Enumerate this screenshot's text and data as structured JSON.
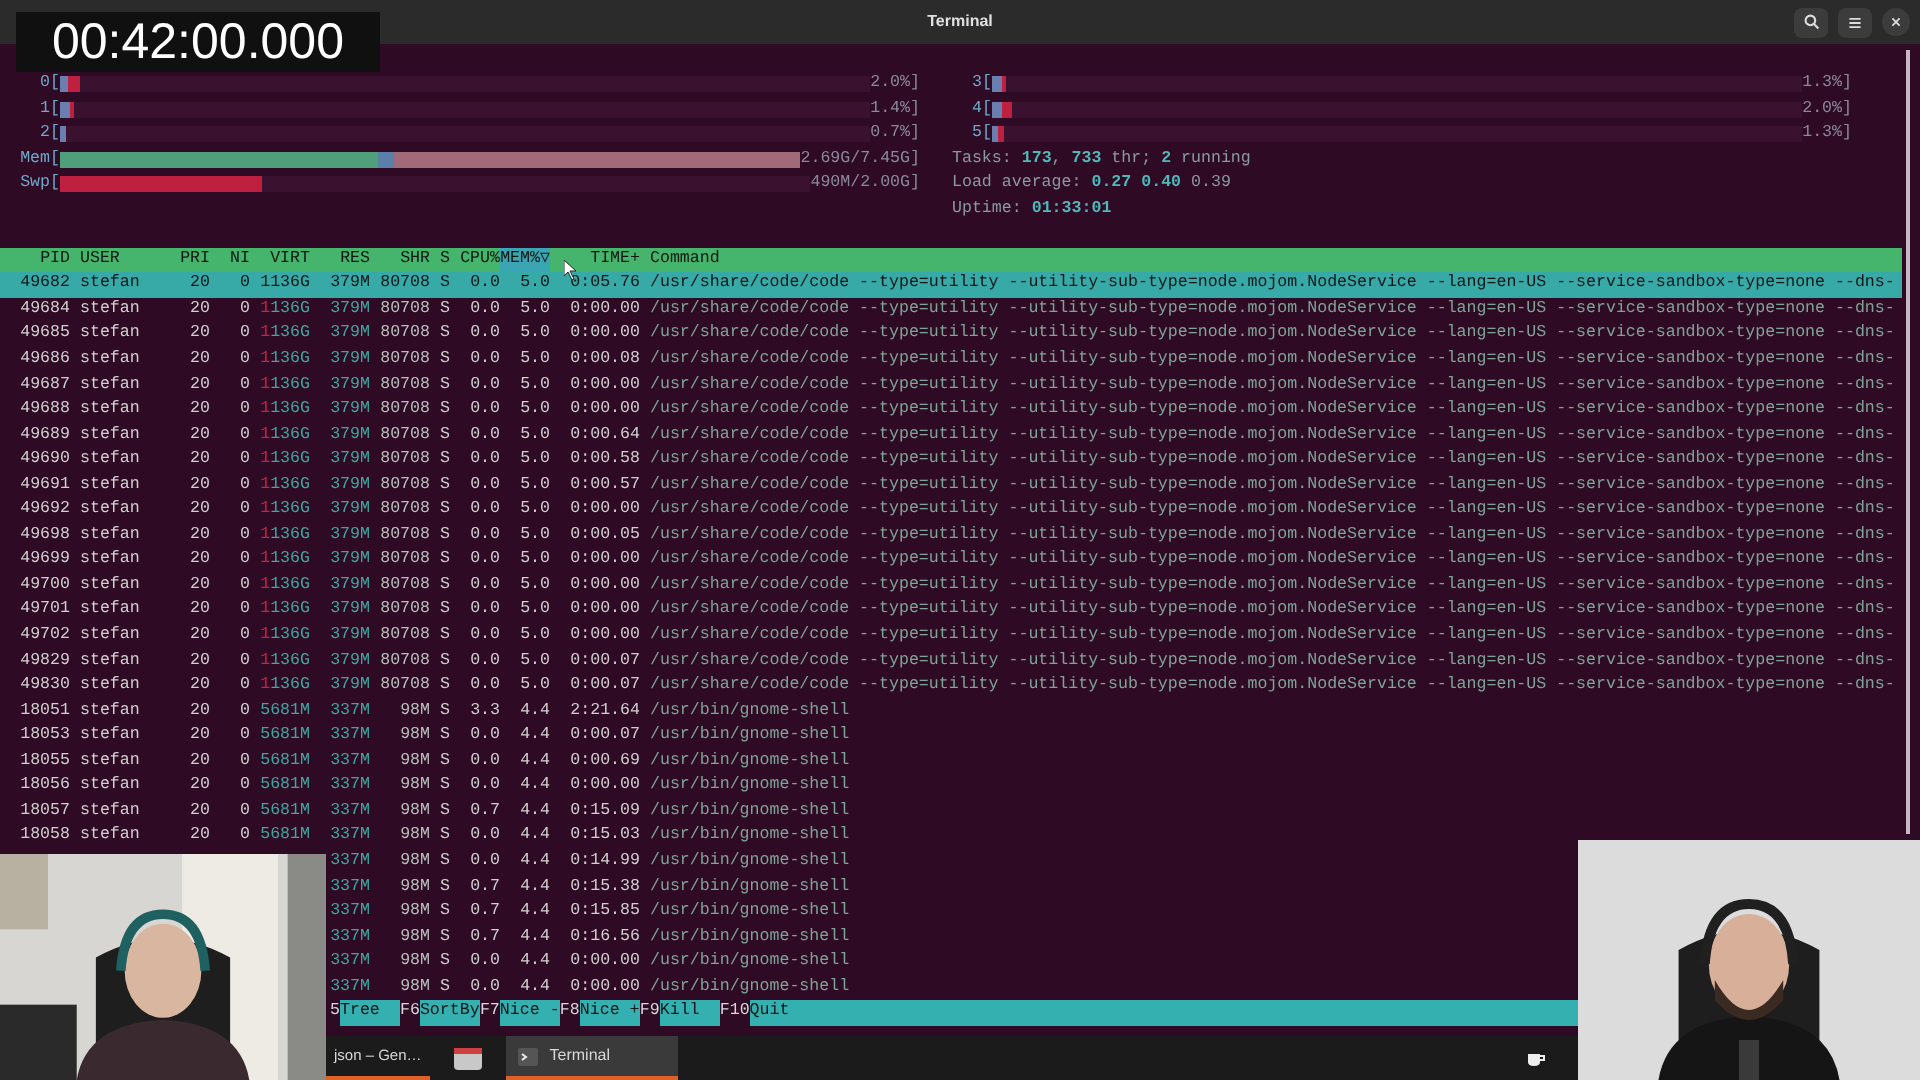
{
  "timer": "00:42:00.000",
  "window": {
    "title": "Terminal"
  },
  "left_meters": [
    {
      "label": "0[",
      "value": "2.0%]",
      "segments": [
        {
          "level": 0.01,
          "color": "#6a7fb0"
        },
        {
          "level": 0.015,
          "color": "#c02040"
        }
      ]
    },
    {
      "label": "1[",
      "value": "1.4%]",
      "segments": [
        {
          "level": 0.012,
          "color": "#6a7fb0"
        },
        {
          "level": 0.005,
          "color": "#c02040"
        }
      ]
    },
    {
      "label": "2[",
      "value": "0.7%]",
      "segments": [
        {
          "level": 0.007,
          "color": "#6a7fb0"
        }
      ]
    },
    {
      "label": "Mem[",
      "value": "2.69G/7.45G]",
      "segments": [
        {
          "level": 0.43,
          "color": "#4fa07a"
        },
        {
          "level": 0.02,
          "color": "#5a7fa8"
        },
        {
          "level": 0.55,
          "color": "#a06a7a"
        }
      ]
    },
    {
      "label": "Swp[",
      "value": "490M/2.00G]",
      "segments": [
        {
          "level": 0.27,
          "color": "#c02040"
        }
      ]
    }
  ],
  "right_meters": [
    {
      "label": "3[",
      "value": "1.3%]",
      "segments": [
        {
          "level": 0.012,
          "color": "#6a7fb0"
        },
        {
          "level": 0.005,
          "color": "#c02040"
        }
      ]
    },
    {
      "label": "4[",
      "value": "2.0%]",
      "segments": [
        {
          "level": 0.012,
          "color": "#6a7fb0"
        },
        {
          "level": 0.012,
          "color": "#c02040"
        }
      ]
    },
    {
      "label": "5[",
      "value": "1.3%]",
      "segments": [
        {
          "level": 0.008,
          "color": "#6a7fb0"
        },
        {
          "level": 0.006,
          "color": "#c02040"
        }
      ]
    }
  ],
  "summary": [
    "Tasks: **173**, **733** thr; **2** running",
    "Load average: **0.27** **0.40** 0.39",
    "Uptime: **01:33:01**"
  ],
  "table": {
    "columns": [
      {
        "label": "PID",
        "selected": false
      },
      {
        "label": "USER",
        "selected": false
      },
      {
        "label": "PRI",
        "selected": false
      },
      {
        "label": "NI",
        "selected": false
      },
      {
        "label": "VIRT",
        "selected": false
      },
      {
        "label": "RES",
        "selected": false
      },
      {
        "label": "SHR",
        "selected": false
      },
      {
        "label": "S",
        "selected": false
      },
      {
        "label": "CPU%",
        "selected": false
      },
      {
        "label": "MEM%▽",
        "selected": true
      },
      {
        "label": "TIME+",
        "selected": false
      },
      {
        "label": "Command",
        "selected": false
      }
    ],
    "rows": [
      {
        "kind": "full",
        "selected": true,
        "cells": [
          "49682",
          "stefan",
          "20",
          "0",
          "1136G",
          "379M",
          "80708",
          "S",
          "0.0",
          "5.0",
          "0:05.76",
          "/usr/share/code/code --type=utility --utility-sub-type=node.mojom.NodeService --lang=en-US --service-sandbox-type=none --dns-"
        ]
      },
      {
        "kind": "full",
        "selected": false,
        "cells": [
          "49684",
          "stefan",
          "20",
          "0",
          "1136G",
          "379M",
          "80708",
          "S",
          "0.0",
          "5.0",
          "0:00.00",
          "/usr/share/code/code --type=utility --utility-sub-type=node.mojom.NodeService --lang=en-US --service-sandbox-type=none --dns-"
        ]
      },
      {
        "kind": "full",
        "selected": false,
        "cells": [
          "49685",
          "stefan",
          "20",
          "0",
          "1136G",
          "379M",
          "80708",
          "S",
          "0.0",
          "5.0",
          "0:00.00",
          "/usr/share/code/code --type=utility --utility-sub-type=node.mojom.NodeService --lang=en-US --service-sandbox-type=none --dns-"
        ]
      },
      {
        "kind": "full",
        "selected": false,
        "cells": [
          "49686",
          "stefan",
          "20",
          "0",
          "1136G",
          "379M",
          "80708",
          "S",
          "0.0",
          "5.0",
          "0:00.08",
          "/usr/share/code/code --type=utility --utility-sub-type=node.mojom.NodeService --lang=en-US --service-sandbox-type=none --dns-"
        ]
      },
      {
        "kind": "full",
        "selected": false,
        "cells": [
          "49687",
          "stefan",
          "20",
          "0",
          "1136G",
          "379M",
          "80708",
          "S",
          "0.0",
          "5.0",
          "0:00.00",
          "/usr/share/code/code --type=utility --utility-sub-type=node.mojom.NodeService --lang=en-US --service-sandbox-type=none --dns-"
        ]
      },
      {
        "kind": "full",
        "selected": false,
        "cells": [
          "49688",
          "stefan",
          "20",
          "0",
          "1136G",
          "379M",
          "80708",
          "S",
          "0.0",
          "5.0",
          "0:00.00",
          "/usr/share/code/code --type=utility --utility-sub-type=node.mojom.NodeService --lang=en-US --service-sandbox-type=none --dns-"
        ]
      },
      {
        "kind": "full",
        "selected": false,
        "cells": [
          "49689",
          "stefan",
          "20",
          "0",
          "1136G",
          "379M",
          "80708",
          "S",
          "0.0",
          "5.0",
          "0:00.64",
          "/usr/share/code/code --type=utility --utility-sub-type=node.mojom.NodeService --lang=en-US --service-sandbox-type=none --dns-"
        ]
      },
      {
        "kind": "full",
        "selected": false,
        "cells": [
          "49690",
          "stefan",
          "20",
          "0",
          "1136G",
          "379M",
          "80708",
          "S",
          "0.0",
          "5.0",
          "0:00.58",
          "/usr/share/code/code --type=utility --utility-sub-type=node.mojom.NodeService --lang=en-US --service-sandbox-type=none --dns-"
        ]
      },
      {
        "kind": "full",
        "selected": false,
        "cells": [
          "49691",
          "stefan",
          "20",
          "0",
          "1136G",
          "379M",
          "80708",
          "S",
          "0.0",
          "5.0",
          "0:00.57",
          "/usr/share/code/code --type=utility --utility-sub-type=node.mojom.NodeService --lang=en-US --service-sandbox-type=none --dns-"
        ]
      },
      {
        "kind": "full",
        "selected": false,
        "cells": [
          "49692",
          "stefan",
          "20",
          "0",
          "1136G",
          "379M",
          "80708",
          "S",
          "0.0",
          "5.0",
          "0:00.00",
          "/usr/share/code/code --type=utility --utility-sub-type=node.mojom.NodeService --lang=en-US --service-sandbox-type=none --dns-"
        ]
      },
      {
        "kind": "full",
        "selected": false,
        "cells": [
          "49698",
          "stefan",
          "20",
          "0",
          "1136G",
          "379M",
          "80708",
          "S",
          "0.0",
          "5.0",
          "0:00.05",
          "/usr/share/code/code --type=utility --utility-sub-type=node.mojom.NodeService --lang=en-US --service-sandbox-type=none --dns-"
        ]
      },
      {
        "kind": "full",
        "selected": false,
        "cells": [
          "49699",
          "stefan",
          "20",
          "0",
          "1136G",
          "379M",
          "80708",
          "S",
          "0.0",
          "5.0",
          "0:00.00",
          "/usr/share/code/code --type=utility --utility-sub-type=node.mojom.NodeService --lang=en-US --service-sandbox-type=none --dns-"
        ]
      },
      {
        "kind": "full",
        "selected": false,
        "cells": [
          "49700",
          "stefan",
          "20",
          "0",
          "1136G",
          "379M",
          "80708",
          "S",
          "0.0",
          "5.0",
          "0:00.00",
          "/usr/share/code/code --type=utility --utility-sub-type=node.mojom.NodeService --lang=en-US --service-sandbox-type=none --dns-"
        ]
      },
      {
        "kind": "full",
        "selected": false,
        "cells": [
          "49701",
          "stefan",
          "20",
          "0",
          "1136G",
          "379M",
          "80708",
          "S",
          "0.0",
          "5.0",
          "0:00.00",
          "/usr/share/code/code --type=utility --utility-sub-type=node.mojom.NodeService --lang=en-US --service-sandbox-type=none --dns-"
        ]
      },
      {
        "kind": "full",
        "selected": false,
        "cells": [
          "49702",
          "stefan",
          "20",
          "0",
          "1136G",
          "379M",
          "80708",
          "S",
          "0.0",
          "5.0",
          "0:00.00",
          "/usr/share/code/code --type=utility --utility-sub-type=node.mojom.NodeService --lang=en-US --service-sandbox-type=none --dns-"
        ]
      },
      {
        "kind": "full",
        "selected": false,
        "cells": [
          "49829",
          "stefan",
          "20",
          "0",
          "1136G",
          "379M",
          "80708",
          "S",
          "0.0",
          "5.0",
          "0:00.07",
          "/usr/share/code/code --type=utility --utility-sub-type=node.mojom.NodeService --lang=en-US --service-sandbox-type=none --dns-"
        ]
      },
      {
        "kind": "full",
        "selected": false,
        "cells": [
          "49830",
          "stefan",
          "20",
          "0",
          "1136G",
          "379M",
          "80708",
          "S",
          "0.0",
          "5.0",
          "0:00.07",
          "/usr/share/code/code --type=utility --utility-sub-type=node.mojom.NodeService --lang=en-US --service-sandbox-type=none --dns-"
        ]
      },
      {
        "kind": "full",
        "selected": false,
        "cells": [
          "18051",
          "stefan",
          "20",
          "0",
          "5681M",
          "337M",
          "98M",
          "S",
          "3.3",
          "4.4",
          "2:21.64",
          "/usr/bin/gnome-shell"
        ]
      },
      {
        "kind": "full",
        "selected": false,
        "cells": [
          "18053",
          "stefan",
          "20",
          "0",
          "5681M",
          "337M",
          "98M",
          "S",
          "0.0",
          "4.4",
          "0:00.07",
          "/usr/bin/gnome-shell"
        ]
      },
      {
        "kind": "full",
        "selected": false,
        "cells": [
          "18055",
          "stefan",
          "20",
          "0",
          "5681M",
          "337M",
          "98M",
          "S",
          "0.0",
          "4.4",
          "0:00.69",
          "/usr/bin/gnome-shell"
        ]
      },
      {
        "kind": "full",
        "selected": false,
        "cells": [
          "18056",
          "stefan",
          "20",
          "0",
          "5681M",
          "337M",
          "98M",
          "S",
          "0.0",
          "4.4",
          "0:00.00",
          "/usr/bin/gnome-shell"
        ]
      },
      {
        "kind": "full",
        "selected": false,
        "cells": [
          "18057",
          "stefan",
          "20",
          "0",
          "5681M",
          "337M",
          "98M",
          "S",
          "0.7",
          "4.4",
          "0:15.09",
          "/usr/bin/gnome-shell"
        ]
      },
      {
        "kind": "full",
        "selected": false,
        "cells": [
          "18058",
          "stefan",
          "20",
          "0",
          "5681M",
          "337M",
          "98M",
          "S",
          "0.0",
          "4.4",
          "0:15.03",
          "/usr/bin/gnome-shell"
        ]
      },
      {
        "kind": "covered",
        "selected": false,
        "cells": [
          "337M",
          "98M",
          "S",
          "0.0",
          "4.4",
          "0:14.99",
          "/usr/bin/gnome-shell"
        ]
      },
      {
        "kind": "covered",
        "selected": false,
        "cells": [
          "337M",
          "98M",
          "S",
          "0.7",
          "4.4",
          "0:15.38",
          "/usr/bin/gnome-shell"
        ]
      },
      {
        "kind": "covered",
        "selected": false,
        "cells": [
          "337M",
          "98M",
          "S",
          "0.7",
          "4.4",
          "0:15.85",
          "/usr/bin/gnome-shell"
        ]
      },
      {
        "kind": "covered",
        "selected": false,
        "cells": [
          "337M",
          "98M",
          "S",
          "0.7",
          "4.4",
          "0:16.56",
          "/usr/bin/gnome-shell"
        ]
      },
      {
        "kind": "covered",
        "selected": false,
        "cells": [
          "337M",
          "98M",
          "S",
          "0.0",
          "4.4",
          "0:00.00",
          "/usr/bin/gnome-shell"
        ]
      },
      {
        "kind": "covered",
        "selected": false,
        "cells": [
          "337M",
          "98M",
          "S",
          "0.0",
          "4.4",
          "0:00.00",
          "/usr/bin/gnome-shell"
        ]
      }
    ]
  },
  "function_keys": [
    {
      "key": "5",
      "label": "Tree"
    },
    {
      "key": "F6",
      "label": "SortBy"
    },
    {
      "key": "F7",
      "label": "Nice -"
    },
    {
      "key": "F8",
      "label": "Nice +"
    },
    {
      "key": "F9",
      "label": "Kill"
    },
    {
      "key": "F10",
      "label": "Quit"
    }
  ],
  "taskbar": [
    {
      "kind": "app",
      "label": "json – Gen…",
      "selected": false
    },
    {
      "kind": "folder",
      "selected": false
    },
    {
      "kind": "terminal",
      "label": "Terminal",
      "selected": true
    }
  ]
}
